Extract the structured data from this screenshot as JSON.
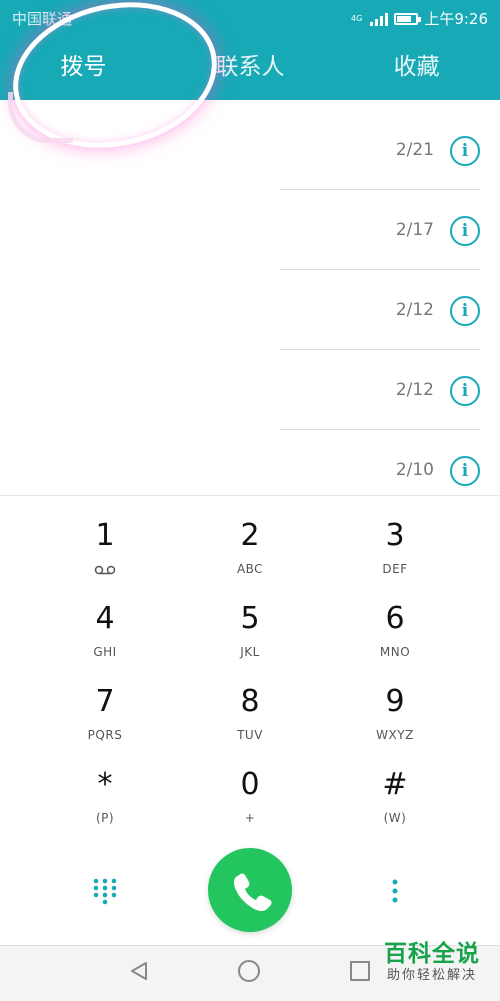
{
  "status_bar": {
    "carrier": "中国联通",
    "network": "4G",
    "time": "上午9:26"
  },
  "tabs": [
    {
      "label": "拨号"
    },
    {
      "label": "联系人"
    },
    {
      "label": "收藏"
    }
  ],
  "call_log": [
    {
      "date": "2/21"
    },
    {
      "date": "2/17"
    },
    {
      "date": "2/12"
    },
    {
      "date": "2/12"
    },
    {
      "date": "2/10"
    }
  ],
  "keypad": [
    {
      "digit": "1",
      "letters": ""
    },
    {
      "digit": "2",
      "letters": "ABC"
    },
    {
      "digit": "3",
      "letters": "DEF"
    },
    {
      "digit": "4",
      "letters": "GHI"
    },
    {
      "digit": "5",
      "letters": "JKL"
    },
    {
      "digit": "6",
      "letters": "MNO"
    },
    {
      "digit": "7",
      "letters": "PQRS"
    },
    {
      "digit": "8",
      "letters": "TUV"
    },
    {
      "digit": "9",
      "letters": "WXYZ"
    },
    {
      "digit": "*",
      "letters": "(P)"
    },
    {
      "digit": "0",
      "letters": "+"
    },
    {
      "digit": "#",
      "letters": "(W)"
    }
  ],
  "watermark": {
    "title": "百科全说",
    "subtitle": "助你轻松解决"
  },
  "colors": {
    "accent": "#17a9b6",
    "call": "#22c55e",
    "watermark": "#16a34a"
  },
  "icons": {
    "info": "info-icon",
    "call": "phone-icon",
    "dialpad": "dialpad-icon",
    "more": "more-vertical-icon",
    "voicemail": "voicemail-icon"
  }
}
